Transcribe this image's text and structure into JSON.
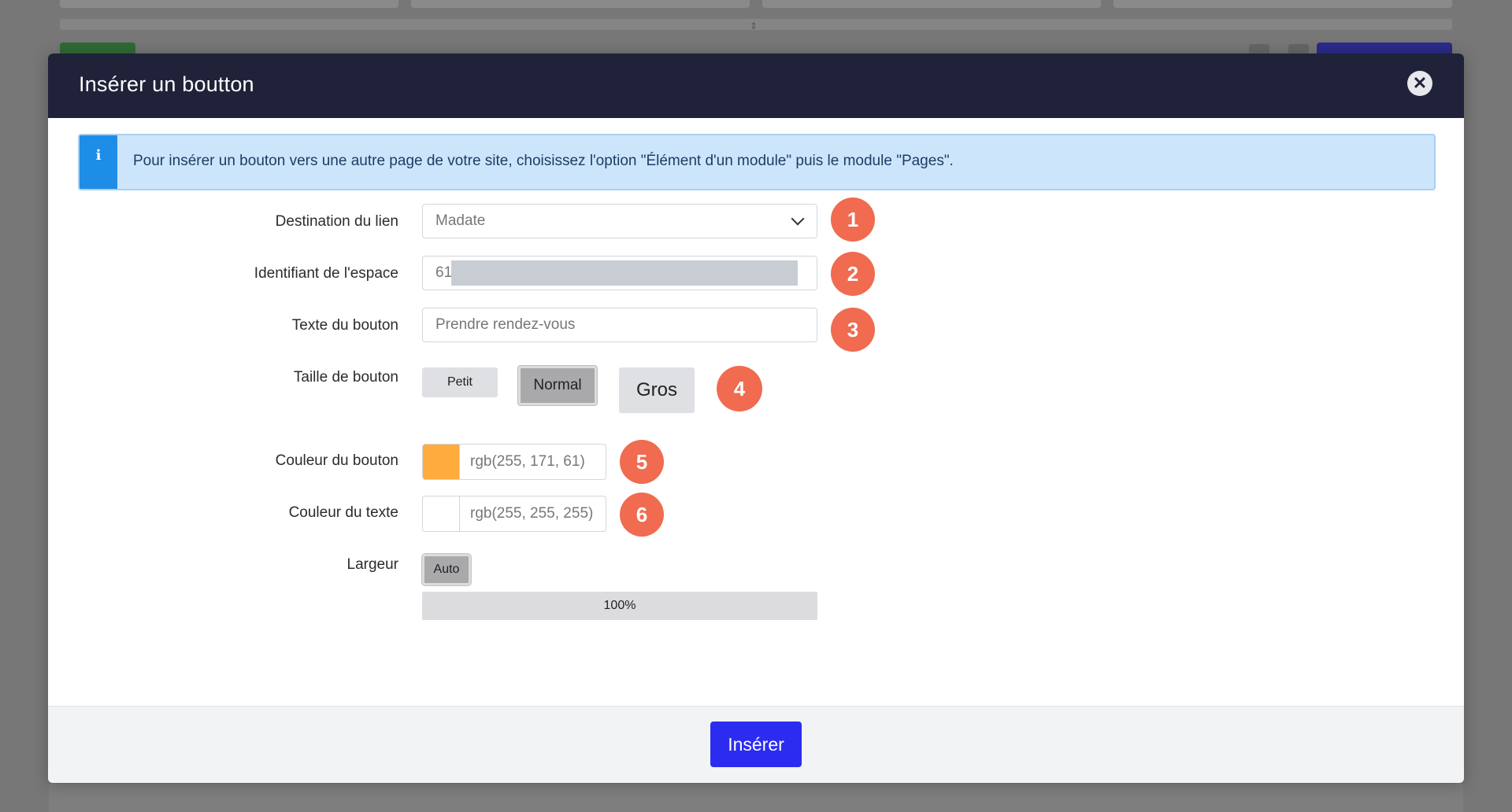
{
  "dialog": {
    "title": "Insérer un boutton"
  },
  "info_alert": {
    "icon": "info-icon",
    "text": "Pour insérer un bouton vers une autre page de votre site, choisissez l'option \"Élément d'un module\" puis le module \"Pages\"."
  },
  "form": {
    "destination": {
      "label": "Destination du lien",
      "value": "Madate"
    },
    "space_id": {
      "label": "Identifiant de l'espace",
      "value": "61"
    },
    "button_text": {
      "label": "Texte du bouton",
      "placeholder": "Prendre rendez-vous"
    },
    "size": {
      "label": "Taille de bouton",
      "options": [
        "Petit",
        "Normal",
        "Gros"
      ],
      "selected": "Normal"
    },
    "button_color": {
      "label": "Couleur du bouton",
      "value": "rgb(255, 171, 61)",
      "swatch": "#ffab3d"
    },
    "text_color": {
      "label": "Couleur du texte",
      "value": "rgb(255, 255, 255)",
      "swatch": "#ffffff"
    },
    "width": {
      "label": "Largeur",
      "auto_label": "Auto",
      "bar_label": "100%"
    }
  },
  "annotations": [
    "1",
    "2",
    "3",
    "4",
    "5",
    "6"
  ],
  "footer": {
    "insert_label": "Insérer"
  },
  "colors": {
    "header": "#1f2238",
    "accent": "#2c2cf0",
    "badge": "#f06b50",
    "alert_bg": "#cde5fb"
  }
}
